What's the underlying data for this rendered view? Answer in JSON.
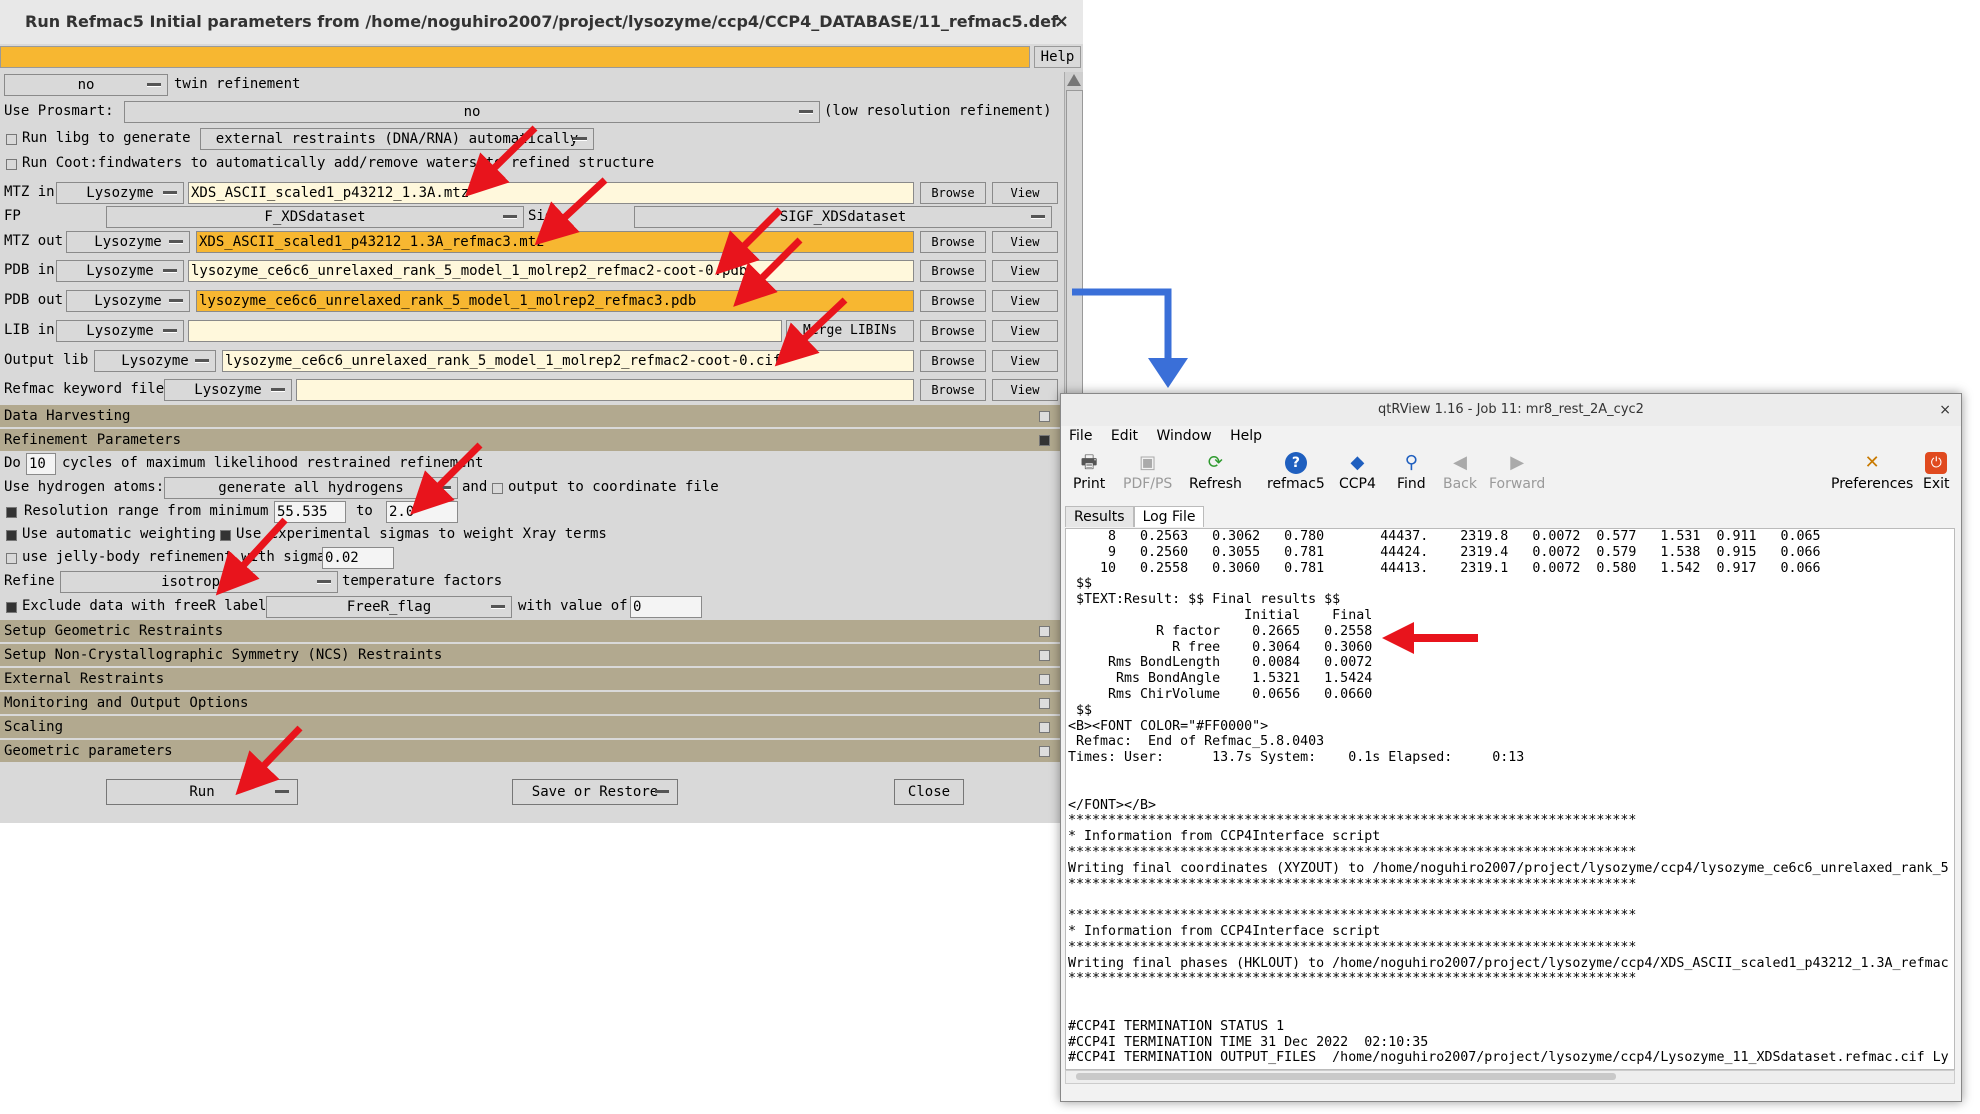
{
  "colors": {
    "accent_orange": "#f7b731",
    "entry_yellow": "#fff8dc",
    "section_tan": "#b2a98f",
    "arrow_red": "#e8141c",
    "connector_blue": "#3a6fd8"
  },
  "refmac": {
    "title": "Run Refmac5 Initial parameters from /home/noguhiro2007/project/lysozyme/ccp4/CCP4_DATABASE/11_refmac5.def",
    "close": "×",
    "help": "Help",
    "twin": {
      "value": "no",
      "label": "twin refinement"
    },
    "prosmart": {
      "label": "Use Prosmart:",
      "value": "no",
      "suffix": "(low resolution refinement)"
    },
    "libg": {
      "label": "Run libg to generate",
      "value": "external restraints (DNA/RNA) automatically"
    },
    "coot": {
      "label": "Run Coot:findwaters to automatically add/remove waters to refined structure"
    },
    "files": [
      {
        "label": "MTZ in",
        "project": "Lysozyme",
        "file": "XDS_ASCII_scaled1_p43212_1.3A.mtz",
        "out": false
      },
      {
        "label": "MTZ out",
        "project": "Lysozyme",
        "file": "XDS_ASCII_scaled1_p43212_1.3A_refmac3.mtz",
        "out": true
      },
      {
        "label": "PDB in",
        "project": "Lysozyme",
        "file": "lysozyme_ce6c6_unrelaxed_rank_5_model_1_molrep2_refmac2-coot-0.pdb",
        "out": false
      },
      {
        "label": "PDB out",
        "project": "Lysozyme",
        "file": "lysozyme_ce6c6_unrelaxed_rank_5_model_1_molrep2_refmac3.pdb",
        "out": true
      },
      {
        "label": "LIB in",
        "project": "Lysozyme",
        "file": "",
        "out": false
      },
      {
        "label": "Output lib",
        "project": "Lysozyme",
        "file": "lysozyme_ce6c6_unrelaxed_rank_5_model_1_molrep2_refmac2-coot-0.cif",
        "out": false
      },
      {
        "label": "Refmac keyword file",
        "project": "Lysozyme",
        "file": "",
        "out": false
      }
    ],
    "fp": {
      "label": "FP",
      "value": "F_XDSdataset",
      "sig_label": "Sig",
      "sig_value": "SIGF_XDSdataset"
    },
    "browse": "Browse",
    "view": "View",
    "merge_libins": "Merge LIBINs",
    "sections_top": [
      "Data Harvesting",
      "Refinement Parameters"
    ],
    "refine": {
      "do_label": "Do",
      "cycles": "10",
      "cycles_text": "cycles of maximum likelihood restrained refinement",
      "hydrogen_label": "Use hydrogen atoms:",
      "hydrogen_value": "generate all hydrogens",
      "hydrogen_and": "and",
      "hydrogen_output": "output to coordinate file",
      "resolution_label": "Resolution range from minimum",
      "res_min": "55.535",
      "res_to": "to",
      "res_max": "2.0",
      "auto_weight": "Use automatic weighting",
      "exp_sigmas": "Use experimental sigmas to weight Xray terms",
      "jelly_label": "use jelly-body refinement with sigma",
      "jelly_sigma": "0.02",
      "refine_label": "Refine",
      "refine_value": "isotropic",
      "refine_suffix": "temperature factors",
      "exclude_label": "Exclude data with freeR label",
      "freer_value": "FreeR_flag",
      "with_value": "with value of",
      "freer_num": "0"
    },
    "sections_bottom": [
      "Setup Geometric Restraints",
      "Setup Non-Crystallographic Symmetry (NCS) Restraints",
      "External Restraints",
      "Monitoring and Output Options",
      "Scaling",
      "Geometric parameters"
    ],
    "run": "Run",
    "save_restore": "Save or Restore",
    "close_btn": "Close"
  },
  "qtr": {
    "title": "qtRView 1.16 - Job 11: mr8_rest_2A_cyc2",
    "close": "×",
    "menu": [
      "File",
      "Edit",
      "Window",
      "Help"
    ],
    "tools": [
      {
        "label": "Print",
        "icon": "printer-icon",
        "enabled": true
      },
      {
        "label": "PDF/PS",
        "icon": "save-icon",
        "enabled": false
      },
      {
        "label": "Refresh",
        "icon": "refresh-icon",
        "enabled": true
      },
      {
        "label": "refmac5",
        "icon": "help-icon",
        "enabled": true
      },
      {
        "label": "CCP4",
        "icon": "ccp4-icon",
        "enabled": true
      },
      {
        "label": "Find",
        "icon": "search-icon",
        "enabled": true
      },
      {
        "label": "Back",
        "icon": "back-icon",
        "enabled": false
      },
      {
        "label": "Forward",
        "icon": "forward-icon",
        "enabled": false
      },
      {
        "label": "Preferences",
        "icon": "preferences-icon",
        "enabled": true
      },
      {
        "label": "Exit",
        "icon": "exit-icon",
        "enabled": true
      }
    ],
    "tabs": [
      "Results",
      "Log File"
    ],
    "log": "     8   0.2563   0.3062   0.780       44437.    2319.8   0.0072  0.577   1.531  0.911   0.065\n     9   0.2560   0.3055   0.781       44424.    2319.4   0.0072  0.579   1.538  0.915   0.066\n    10   0.2558   0.3060   0.781       44413.    2319.1   0.0072  0.580   1.542  0.917   0.066\n $$\n $TEXT:Result: $$ Final results $$\n                      Initial    Final\n           R factor    0.2665   0.2558\n             R free    0.3064   0.3060\n     Rms BondLength    0.0084   0.0072\n      Rms BondAngle    1.5321   1.5424\n     Rms ChirVolume    0.0656   0.0660\n $$\n<B><FONT COLOR=\"#FF0000\">\n Refmac:  End of Refmac_5.8.0403\nTimes: User:      13.7s System:    0.1s Elapsed:     0:13\n\n\n</FONT></B>\n***********************************************************************\n* Information from CCP4Interface script\n***********************************************************************\nWriting final coordinates (XYZOUT) to /home/noguhiro2007/project/lysozyme/ccp4/lysozyme_ce6c6_unrelaxed_rank_5\n***********************************************************************\n\n***********************************************************************\n* Information from CCP4Interface script\n***********************************************************************\nWriting final phases (HKLOUT) to /home/noguhiro2007/project/lysozyme/ccp4/XDS_ASCII_scaled1_p43212_1.3A_refmac\n***********************************************************************\n\n\n#CCP4I TERMINATION STATUS 1\n#CCP4I TERMINATION TIME 31 Dec 2022  02:10:35\n#CCP4I TERMINATION OUTPUT_FILES  /home/noguhiro2007/project/lysozyme/ccp4/Lysozyme_11_XDSdataset.refmac.cif Ly"
  }
}
